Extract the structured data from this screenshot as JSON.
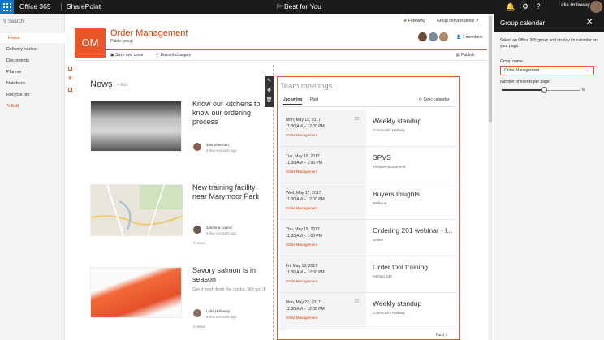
{
  "suite": {
    "app": "Office 365",
    "site": "SharePoint",
    "center": "Best for You",
    "user": "Lidia Holloway"
  },
  "nav": {
    "search_placeholder": "Search",
    "items": [
      "Home",
      "Delivery routes",
      "Documents",
      "Planner",
      "Notebook",
      "Recycle bin"
    ],
    "edit": "Edit"
  },
  "site": {
    "logo": "OM",
    "title": "Order Management",
    "subtitle": "Public group",
    "following": "Following",
    "group_conversations": "Group conversations",
    "members": "7 members"
  },
  "cmdbar": {
    "save": "Save and close",
    "discard": "Discard changes",
    "publish": "Publish"
  },
  "news": {
    "title": "News",
    "add": "Add",
    "items": [
      {
        "title": "Know our kitchens to know our ordering process",
        "author": "Joni Sherman",
        "date": "a few seconds ago"
      },
      {
        "title": "New training facility near Marymoor Park",
        "author": "Johanna Lorenz",
        "date": "a few seconds ago",
        "views": "0 views"
      },
      {
        "title": "Savory salmon is in season",
        "desc": "Get it fresh from the docks. We got it!",
        "author": "Lidia Holloway",
        "date": "a few seconds ago",
        "views": "0 views"
      }
    ]
  },
  "meetings": {
    "title": "Team meetings",
    "tabs": [
      "Upcoming",
      "Past"
    ],
    "sync": "Sync calendar",
    "next": "Next",
    "events": [
      {
        "date": "Mon, May 15, 2017",
        "time": "11:30 AM – 12:00 PM",
        "group": "Order Management",
        "name": "Weekly standup",
        "loc": "Community Hallway"
      },
      {
        "date": "Tue, May 16, 2017",
        "time": "11:30 AM – 1:00 PM",
        "group": "Order Management",
        "name": "SPVS",
        "loc": "#SharePointSummit"
      },
      {
        "date": "Wed, May 17, 2017",
        "time": "11:30 AM – 12:00 PM",
        "group": "Order Management",
        "name": "Buyers Insights",
        "loc": "Bellevue"
      },
      {
        "date": "Thu, May 18, 2017",
        "time": "11:30 AM – 1:00 PM",
        "group": "Order Management",
        "name": "Ordering 201 webinar - l...",
        "loc": "Online"
      },
      {
        "date": "Fri, May 19, 2017",
        "time": "11:30 AM – 12:00 PM",
        "group": "Order Management",
        "name": "Order tool training",
        "loc": "Kitchen 234"
      },
      {
        "date": "Mon, May 22, 2017",
        "time": "11:30 AM – 12:00 PM",
        "group": "Order Management",
        "name": "Weekly standup",
        "loc": "Community Hallway"
      }
    ]
  },
  "panel": {
    "title": "Group calendar",
    "desc": "Select an Office 365 group and display its calendar on your page.",
    "group_label": "Group name",
    "group_value": "Order Management",
    "events_label": "Number of events per page",
    "events_value": "6",
    "events_fraction": 0.55
  },
  "colors": {
    "accent": "#e8562a",
    "suite": "#1b1b1b",
    "waffle": "#0078d4"
  }
}
